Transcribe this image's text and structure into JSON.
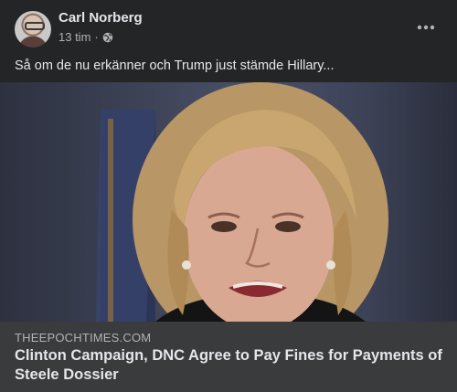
{
  "post": {
    "author": "Carl Norberg",
    "time": "13 tim",
    "separator": "·",
    "privacy_icon": "globe-icon",
    "more_icon": "more-options-icon",
    "text": "Så om de nu erkänner och Trump just stämde Hillary..."
  },
  "link_preview": {
    "domain": "THEEPOCHTIMES.COM",
    "headline": "Clinton Campaign, DNC Agree to Pay Fines for Payments of Steele Dossier",
    "image_description_icon": "news-photo"
  },
  "colors": {
    "background": "#242526",
    "card_footer": "#3a3b3c",
    "primary_text": "#e4e6eb",
    "secondary_text": "#b0b3b8"
  }
}
